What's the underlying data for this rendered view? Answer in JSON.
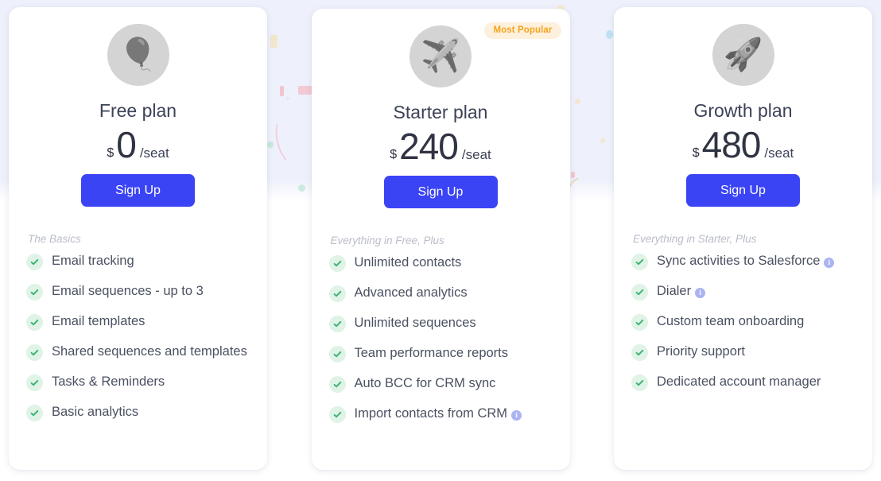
{
  "theme": {
    "accent_blue": "#3b44f5",
    "badge_bg": "#fdf1dd",
    "badge_text": "#f5a21e",
    "check_bg": "#dff3e6",
    "check_color": "#3bb273",
    "info_color": "#aab4f2",
    "band_bg": "#eef1fb",
    "card_bg": "#ffffff"
  },
  "plans": [
    {
      "id": "free",
      "icon": "hot-air-balloon-icon",
      "icon_glyph": "🎈",
      "name": "Free plan",
      "currency": "$",
      "amount": "0",
      "period": "/seat",
      "cta": "Sign Up",
      "badge": null,
      "section_label": "The Basics",
      "features": [
        {
          "text": "Email tracking",
          "info": false
        },
        {
          "text": "Email sequences - up to 3",
          "info": false
        },
        {
          "text": "Email templates",
          "info": false
        },
        {
          "text": "Shared sequences and templates",
          "info": false
        },
        {
          "text": "Tasks & Reminders",
          "info": false
        },
        {
          "text": "Basic analytics",
          "info": false
        }
      ]
    },
    {
      "id": "starter",
      "icon": "airplane-icon",
      "icon_glyph": "✈️",
      "name": "Starter plan",
      "currency": "$",
      "amount": "240",
      "period": "/seat",
      "cta": "Sign Up",
      "badge": "Most Popular",
      "section_label": "Everything in Free, Plus",
      "features": [
        {
          "text": "Unlimited contacts",
          "info": false
        },
        {
          "text": "Advanced analytics",
          "info": false
        },
        {
          "text": "Unlimited sequences",
          "info": false
        },
        {
          "text": "Team performance reports",
          "info": false
        },
        {
          "text": "Auto BCC for CRM sync",
          "info": false
        },
        {
          "text": "Import contacts from CRM",
          "info": true
        }
      ]
    },
    {
      "id": "growth",
      "icon": "rocket-icon",
      "icon_glyph": "🚀",
      "name": "Growth plan",
      "currency": "$",
      "amount": "480",
      "period": "/seat",
      "cta": "Sign Up",
      "badge": null,
      "section_label": "Everything in Starter, Plus",
      "features": [
        {
          "text": "Sync activities to Salesforce",
          "info": true
        },
        {
          "text": "Dialer",
          "info": true
        },
        {
          "text": "Custom team onboarding",
          "info": false
        },
        {
          "text": "Priority support",
          "info": false
        },
        {
          "text": "Dedicated account manager",
          "info": false
        }
      ]
    }
  ],
  "info_icon_label": "i"
}
